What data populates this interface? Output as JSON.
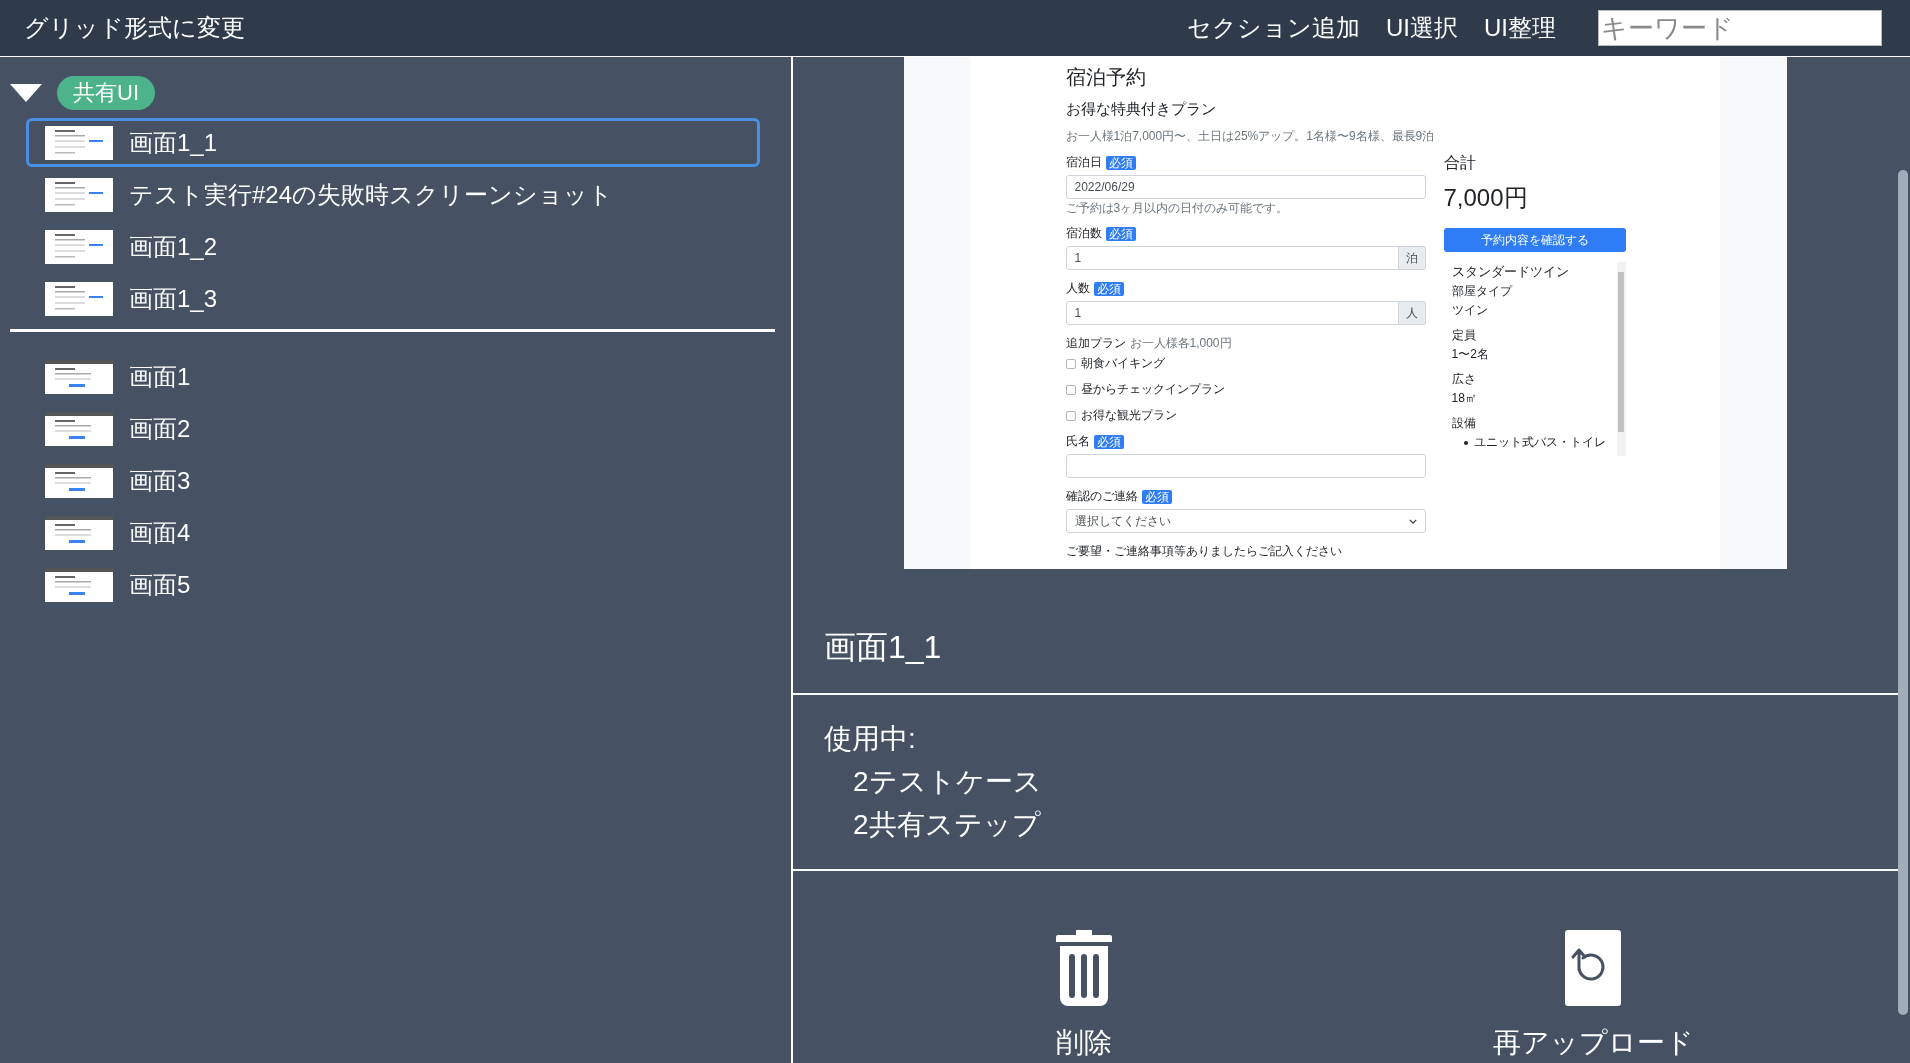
{
  "toolbar": {
    "title": "グリッド形式に変更",
    "actions": [
      "セクション追加",
      "UI選択",
      "UI整理"
    ],
    "search": {
      "placeholder": "キーワード"
    }
  },
  "tree": {
    "groups": [
      {
        "label": "共有UI",
        "expanded": true,
        "children": [
          {
            "label": "画面1_1",
            "selected": true
          },
          {
            "label": "テスト実行#24の失敗時スクリーンショット",
            "selected": false
          },
          {
            "label": "画面1_2",
            "selected": false
          },
          {
            "label": "画面1_3",
            "selected": false
          }
        ]
      }
    ],
    "items": [
      {
        "label": "画面1",
        "selected": false
      },
      {
        "label": "画面2",
        "selected": false
      },
      {
        "label": "画面3",
        "selected": false
      },
      {
        "label": "画面4",
        "selected": false
      },
      {
        "label": "画面5",
        "selected": false
      }
    ]
  },
  "detail": {
    "preview": {
      "title": "宿泊予約",
      "plan": "お得な特典付きプラン",
      "description": "お一人様1泊7,000円〜、土日は25%アップ。1名様〜9名様、最長9泊",
      "fields": [
        {
          "kind": "input",
          "label": "宿泊日",
          "badge": "必須",
          "value": "2022/06/29",
          "note": "ご予約は3ヶ月以内の日付のみ可能です。"
        },
        {
          "kind": "input",
          "label": "宿泊数",
          "badge": "必須",
          "value": "1",
          "unit": "泊"
        },
        {
          "kind": "input",
          "label": "人数",
          "badge": "必須",
          "value": "1",
          "unit": "人"
        },
        {
          "kind": "checkboxes",
          "label": "追加プラン",
          "hint": "お一人様各1,000円",
          "options": [
            {
              "label": "朝食バイキング",
              "checked": false
            },
            {
              "label": "昼からチェックインプラン",
              "checked": false
            },
            {
              "label": "お得な観光プラン",
              "checked": false
            }
          ]
        },
        {
          "kind": "input",
          "label": "氏名",
          "badge": "必須"
        },
        {
          "kind": "select",
          "label": "確認のご連絡",
          "badge": "必須",
          "placeholder": "選択してください"
        },
        {
          "kind": "label",
          "label": "ご要望・ご連絡事項等ありましたらご記入ください"
        }
      ],
      "summary": {
        "total_label": "合計",
        "total": "7,000円",
        "button": "予約内容を確認する",
        "room": {
          "name": "スタンダードツイン",
          "details": [
            {
              "term": "部屋タイプ",
              "value": "ツイン"
            },
            {
              "term": "定員",
              "value": "1〜2名"
            },
            {
              "term": "広さ",
              "value": "18㎡"
            }
          ],
          "facilities_label": "設備",
          "facilities": [
            "ユニット式バス・トイレ"
          ]
        }
      }
    },
    "name": "画面1_1",
    "usage_label": "使用中:",
    "usage": [
      "2テストケース",
      "2共有ステップ"
    ],
    "actions": [
      {
        "kind": "delete",
        "label": "削除"
      },
      {
        "kind": "reupload",
        "label": "再アップロード"
      }
    ]
  }
}
